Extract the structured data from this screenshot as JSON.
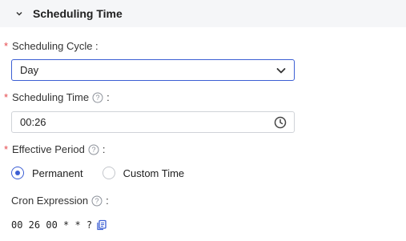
{
  "section": {
    "title": "Scheduling Time",
    "collapse_icon": "chevron-down-icon"
  },
  "scheduling_cycle": {
    "label": "Scheduling Cycle :",
    "required": true,
    "value": "Day"
  },
  "scheduling_time": {
    "label": "Scheduling Time",
    "required": true,
    "value": "00:26",
    "icon": "clock-icon"
  },
  "effective_period": {
    "label": "Effective Period",
    "required": true,
    "options": [
      {
        "label": "Permanent",
        "selected": true
      },
      {
        "label": "Custom Time",
        "selected": false
      }
    ]
  },
  "cron": {
    "label": "Cron Expression",
    "value": "00 26 00 * * ?",
    "copy_icon": "copy-icon"
  },
  "colors": {
    "accent": "#3c5fd4",
    "required": "#e5484d",
    "header_bg": "#f5f6f8"
  }
}
